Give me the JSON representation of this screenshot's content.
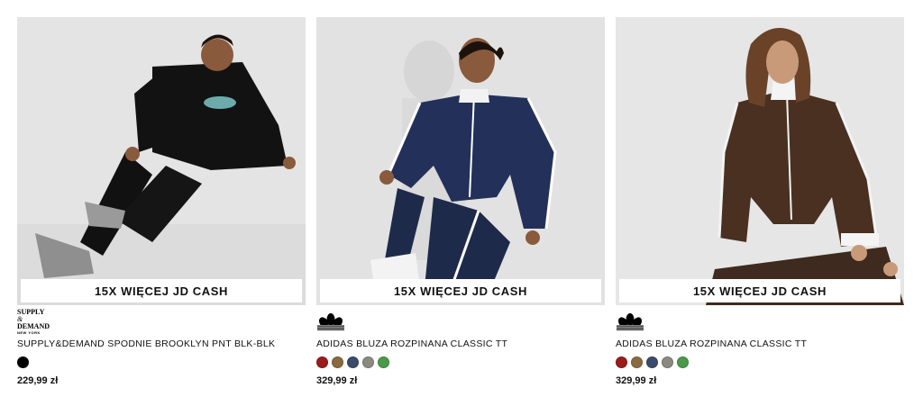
{
  "products": [
    {
      "promo": "15X WIĘCEJ JD CASH",
      "brand": "SUPPLY & DEMAND",
      "brand_logo_text": {
        "line1": "SUPPLY",
        "amp": "&",
        "line2": "DEMAND",
        "line3": "NEW YORK"
      },
      "title": "SUPPLY&DEMAND SPODNIE BROOKLYN PNT BLK-BLK",
      "price": "229,99 zł",
      "swatches": [
        "#000000"
      ],
      "image_icon": "product-photo-black-tracksuit"
    },
    {
      "promo": "15X WIĘCEJ JD CASH",
      "brand": "adidas",
      "title": "ADIDAS BLUZA ROZPINANA CLASSIC TT",
      "price": "329,99 zł",
      "swatches": [
        "#9b1b1b",
        "#8a6a3e",
        "#3c4a6b",
        "#8a8a80",
        "#4a9a4a"
      ],
      "image_icon": "product-photo-navy-track-jacket"
    },
    {
      "promo": "15X WIĘCEJ JD CASH",
      "brand": "adidas",
      "title": "ADIDAS BLUZA ROZPINANA CLASSIC TT",
      "price": "329,99 zł",
      "swatches": [
        "#9b1b1b",
        "#8a6a3e",
        "#3c4a6b",
        "#8a8a80",
        "#4a9a4a"
      ],
      "image_icon": "product-photo-brown-track-jacket"
    }
  ]
}
